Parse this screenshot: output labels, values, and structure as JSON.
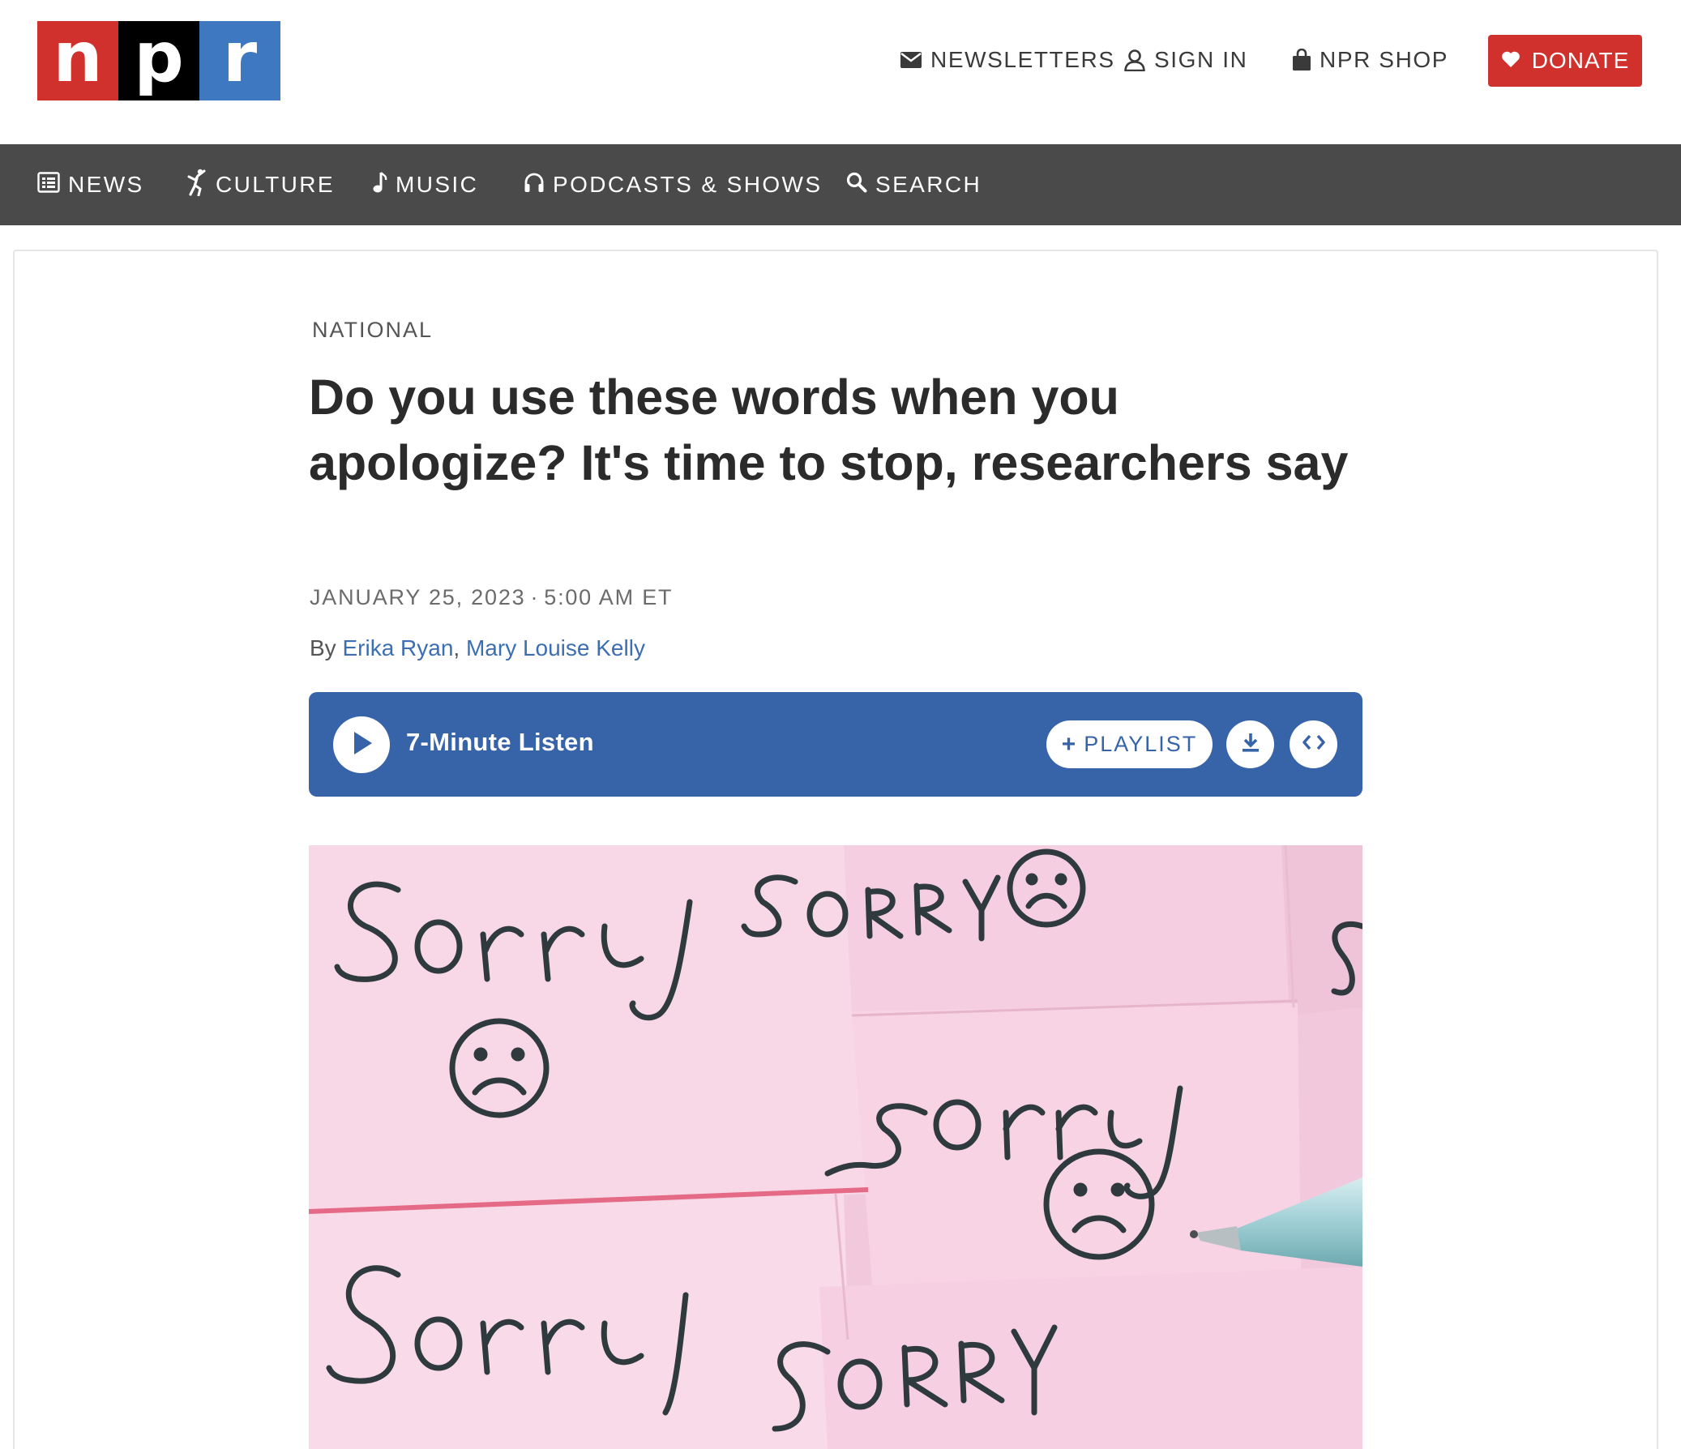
{
  "logo": {
    "letters": [
      "n",
      "p",
      "r"
    ],
    "colors": [
      "#d0312d",
      "#000000",
      "#3d78c1"
    ]
  },
  "utility_nav": {
    "newsletters": "NEWSLETTERS",
    "sign_in": "SIGN IN",
    "shop": "NPR SHOP",
    "donate": "DONATE"
  },
  "main_nav": {
    "items": [
      {
        "label": "NEWS",
        "icon": "news-icon"
      },
      {
        "label": "CULTURE",
        "icon": "culture-icon"
      },
      {
        "label": "MUSIC",
        "icon": "music-note-icon"
      },
      {
        "label": "PODCASTS & SHOWS",
        "icon": "headphones-icon"
      },
      {
        "label": "SEARCH",
        "icon": "search-icon"
      }
    ]
  },
  "article": {
    "section": "NATIONAL",
    "headline": "Do you use these words when you apologize? It's time to stop, researchers say",
    "date": "JANUARY 25, 2023",
    "time": "5:00 AM ET",
    "date_separator": "·",
    "by_prefix": "By",
    "authors": [
      "Erika Ryan",
      "Mary Louise Kelly"
    ],
    "author_separator": ","
  },
  "player": {
    "listen_label": "7-Minute Listen",
    "playlist_label": "PLAYLIST",
    "playlist_prefix": "+"
  },
  "hero_image": {
    "notes": [
      "Sorry",
      "SORRY",
      "Sorry",
      "Sorry",
      "SORRY"
    ]
  },
  "colors": {
    "brand_red": "#d0312d",
    "nav_bg": "#4a4a4a",
    "player_blue": "#3763a9",
    "link_blue": "#3c6eb3",
    "note_pink": "#f6d4e4"
  }
}
